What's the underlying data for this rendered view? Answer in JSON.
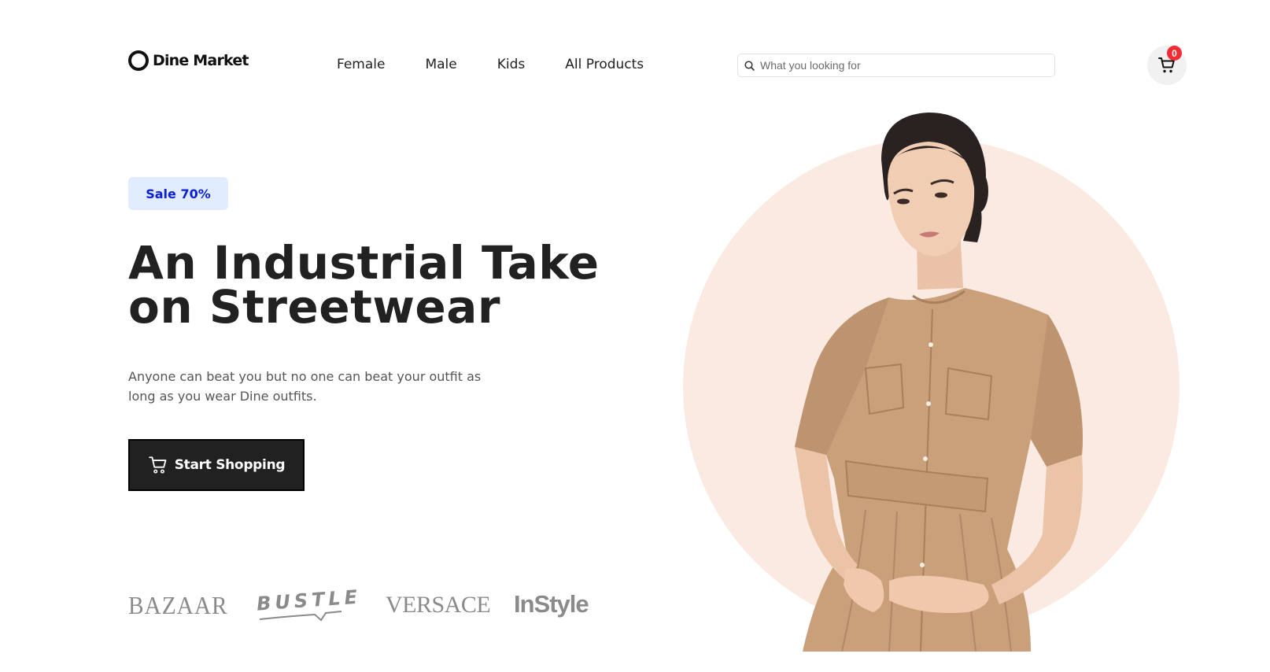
{
  "header": {
    "logo_text": "Dine Market",
    "nav": [
      {
        "label": "Female"
      },
      {
        "label": "Male"
      },
      {
        "label": "Kids"
      },
      {
        "label": "All Products"
      }
    ],
    "search": {
      "placeholder": "What you looking for",
      "value": ""
    },
    "cart": {
      "count": "0"
    }
  },
  "hero": {
    "badge": "Sale 70%",
    "title_line1": "An Industrial Take",
    "title_line2": "on Streetwear",
    "description": "Anyone can beat you but no one can beat your outfit as long as you wear Dine outfits.",
    "cta_label": "Start Shopping",
    "image_alt": "model wearing a tan short-sleeve belted shirt dress"
  },
  "brands": [
    "BAZAAR",
    "BUSTLE",
    "VERSACE",
    "InStyle"
  ],
  "colors": {
    "text": "#212121",
    "badge_bg": "#e1edff",
    "badge_text": "#0a1fd6",
    "cta_bg": "#212121",
    "circle_bg": "#fbeae2",
    "cart_badge": "#f02d34",
    "brand_gray": "#8a8a8a"
  },
  "icons": {
    "logo": "ring-logo-icon",
    "search": "search-icon",
    "cart": "cart-icon",
    "cta": "cart-icon"
  }
}
